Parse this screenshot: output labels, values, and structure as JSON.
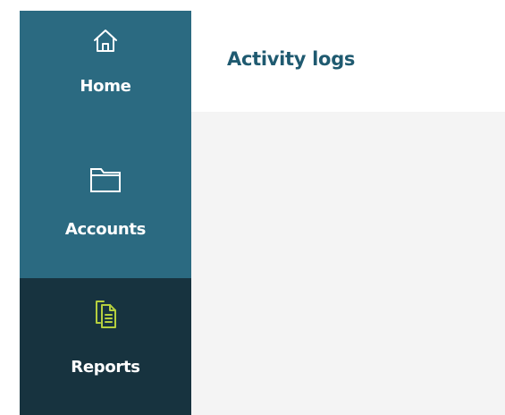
{
  "sidebar": {
    "items": [
      {
        "label": "Home",
        "icon": "home-icon",
        "active": false
      },
      {
        "label": "Accounts",
        "icon": "folder-icon",
        "active": false
      },
      {
        "label": "Reports",
        "icon": "reports-icon",
        "active": true
      }
    ],
    "colors": {
      "background": "#2b6a81",
      "active_background": "#17333f",
      "active_icon": "#b5cf3e",
      "text": "#ffffff"
    }
  },
  "header": {
    "title": "Activity logs",
    "title_color": "#1f5a70"
  },
  "main": {
    "background": "#f4f4f4"
  }
}
